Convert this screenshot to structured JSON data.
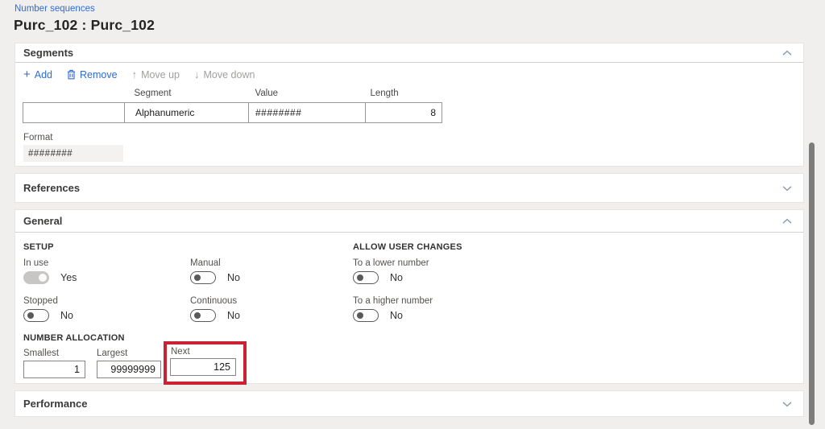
{
  "header": {
    "breadcrumb": "Number sequences",
    "title": "Purc_102 : Purc_102"
  },
  "segments": {
    "title": "Segments",
    "toolbar": {
      "add": "Add",
      "remove": "Remove",
      "move_up": "Move up",
      "move_down": "Move down"
    },
    "table": {
      "headers": {
        "segment": "Segment",
        "value": "Value",
        "length": "Length"
      },
      "row": {
        "segment": "Alphanumeric",
        "value": "########",
        "length": "8"
      }
    },
    "format_label": "Format",
    "format_value": "########"
  },
  "references": {
    "title": "References"
  },
  "general": {
    "title": "General",
    "setup_heading": "SETUP",
    "allow_heading": "ALLOW USER CHANGES",
    "toggles": {
      "in_use": {
        "label": "In use",
        "value": "Yes",
        "state": "on-disabled"
      },
      "manual": {
        "label": "Manual",
        "value": "No",
        "state": "off"
      },
      "stopped": {
        "label": "Stopped",
        "value": "No",
        "state": "off"
      },
      "continuous": {
        "label": "Continuous",
        "value": "No",
        "state": "off"
      },
      "lower": {
        "label": "To a lower number",
        "value": "No",
        "state": "off"
      },
      "higher": {
        "label": "To a higher number",
        "value": "No",
        "state": "off"
      }
    },
    "allocation_heading": "NUMBER ALLOCATION",
    "fields": {
      "smallest": {
        "label": "Smallest",
        "value": "1"
      },
      "largest": {
        "label": "Largest",
        "value": "99999999"
      },
      "next": {
        "label": "Next",
        "value": "125",
        "highlighted": true
      }
    }
  },
  "performance": {
    "title": "Performance"
  },
  "colors": {
    "accent_blue": "#2c6cd6",
    "highlight_red": "#cb2233",
    "page_background": "#f1efee"
  }
}
